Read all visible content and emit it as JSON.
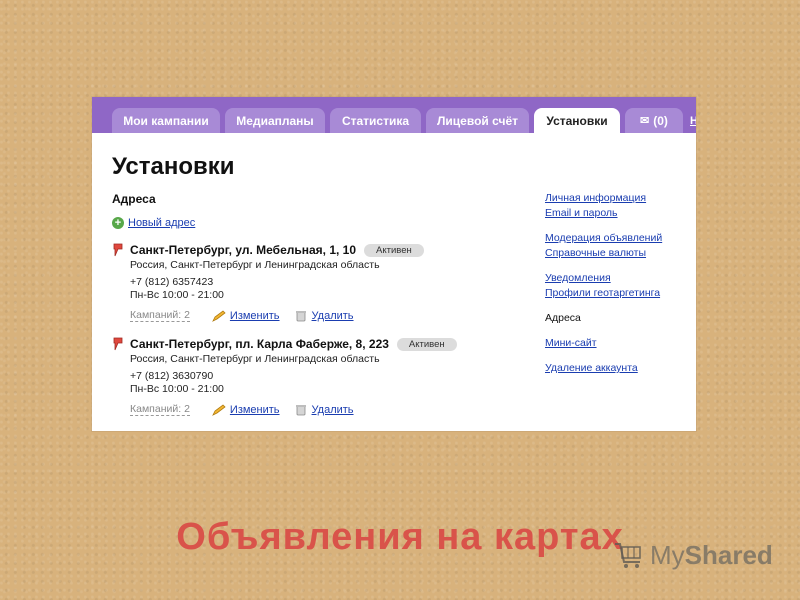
{
  "tabs": [
    {
      "label": "Мои кампании",
      "active": false
    },
    {
      "label": "Медиапланы",
      "active": false
    },
    {
      "label": "Статистика",
      "active": false
    },
    {
      "label": "Лицевой счёт",
      "active": false
    },
    {
      "label": "Установки",
      "active": true
    },
    {
      "label": "(0)",
      "icon": "envelope-icon",
      "active": false
    }
  ],
  "tab_help": "Н",
  "page_title": "Установки",
  "section_title": "Адреса",
  "new_address_label": "Новый адрес",
  "addresses": [
    {
      "name": "Санкт-Петербург, ул. Мебельная, 1, 10",
      "status": "Активен",
      "region": "Россия, Санкт-Петербург и Ленинградская область",
      "phone": "+7 (812) 6357423",
      "hours": "Пн-Вс 10:00 - 21:00",
      "campaigns": "Кампаний: 2",
      "edit": "Изменить",
      "delete": "Удалить"
    },
    {
      "name": "Санкт-Петербург, пл. Карла Фаберже, 8, 223",
      "status": "Активен",
      "region": "Россия, Санкт-Петербург и Ленинградская область",
      "phone": "+7 (812) 3630790",
      "hours": "Пн-Вс 10:00 - 21:00",
      "campaigns": "Кампаний: 2",
      "edit": "Изменить",
      "delete": "Удалить"
    }
  ],
  "sidebar": [
    [
      "Личная информация",
      "Email и пароль"
    ],
    [
      "Модерация объявлений",
      "Справочные валюты"
    ],
    [
      "Уведомления",
      "Профили геотаргетинга"
    ],
    [
      "Адреса"
    ],
    [
      "Мини-сайт"
    ],
    [
      "Удаление аккаунта"
    ]
  ],
  "sidebar_current": "Адреса",
  "slide_title": "Объявления на картах",
  "watermark": {
    "part1": "My",
    "part2": "Shared"
  },
  "colors": {
    "tabbar": "#8f67c6",
    "tab": "#a88ad6",
    "link": "#1a3db0",
    "title": "#d9534a"
  }
}
